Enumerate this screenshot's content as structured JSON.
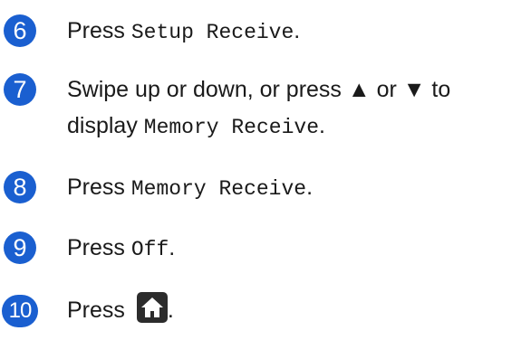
{
  "colors": {
    "accent": "#1a5fd0",
    "dark": "#2c2c2c"
  },
  "steps": [
    {
      "number": "6",
      "pre": "Press ",
      "code": "Setup Receive",
      "post": "."
    },
    {
      "number": "7",
      "line1": "Swipe up or down, or press ▲ or ▼ to",
      "line2_pre": "display ",
      "line2_code": "Memory Receive",
      "line2_post": "."
    },
    {
      "number": "8",
      "pre": "Press ",
      "code": "Memory Receive",
      "post": "."
    },
    {
      "number": "9",
      "pre": "Press ",
      "code": "Off",
      "post": "."
    },
    {
      "number": "10",
      "pre": "Press ",
      "icon": "home-icon",
      "post": "."
    }
  ]
}
